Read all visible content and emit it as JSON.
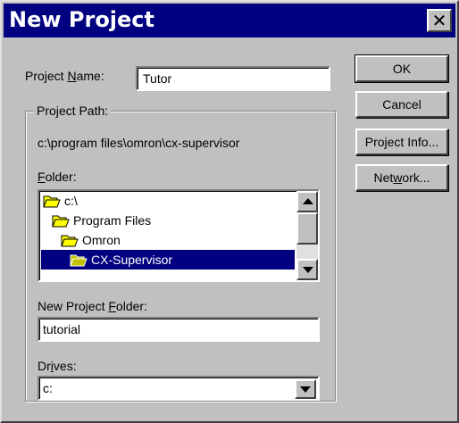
{
  "window": {
    "title": "New Project",
    "close_glyph": "✕"
  },
  "project_name": {
    "label_pre": "Project ",
    "label_accel": "N",
    "label_post": "ame:",
    "value": "Tutor"
  },
  "project_path": {
    "group_label": "Project Path:",
    "path_text": "c:\\program files\\omron\\cx-supervisor"
  },
  "folder": {
    "label_accel": "F",
    "label_post": "older:",
    "items": [
      {
        "label": "c:\\",
        "icon": "open-folder-icon"
      },
      {
        "label": "Program Files",
        "icon": "open-folder-icon"
      },
      {
        "label": "Omron",
        "icon": "open-folder-icon"
      },
      {
        "label": "CX-Supervisor",
        "icon": "open-folder-icon",
        "selected": true
      }
    ]
  },
  "new_folder": {
    "label_pre": "New Project ",
    "label_accel": "F",
    "label_post": "older:",
    "value": "tutorial"
  },
  "drives": {
    "label_pre": "Dr",
    "label_accel": "i",
    "label_post": "ves:",
    "value": "c:"
  },
  "buttons": {
    "ok": "OK",
    "cancel": "Cancel",
    "project_info": "Project Info...",
    "network_pre": "Net",
    "network_accel": "w",
    "network_post": "ork..."
  },
  "colors": {
    "titlebar": "#000080",
    "face": "#c0c0c0",
    "selection": "#000080",
    "folder": "#ffff00"
  }
}
